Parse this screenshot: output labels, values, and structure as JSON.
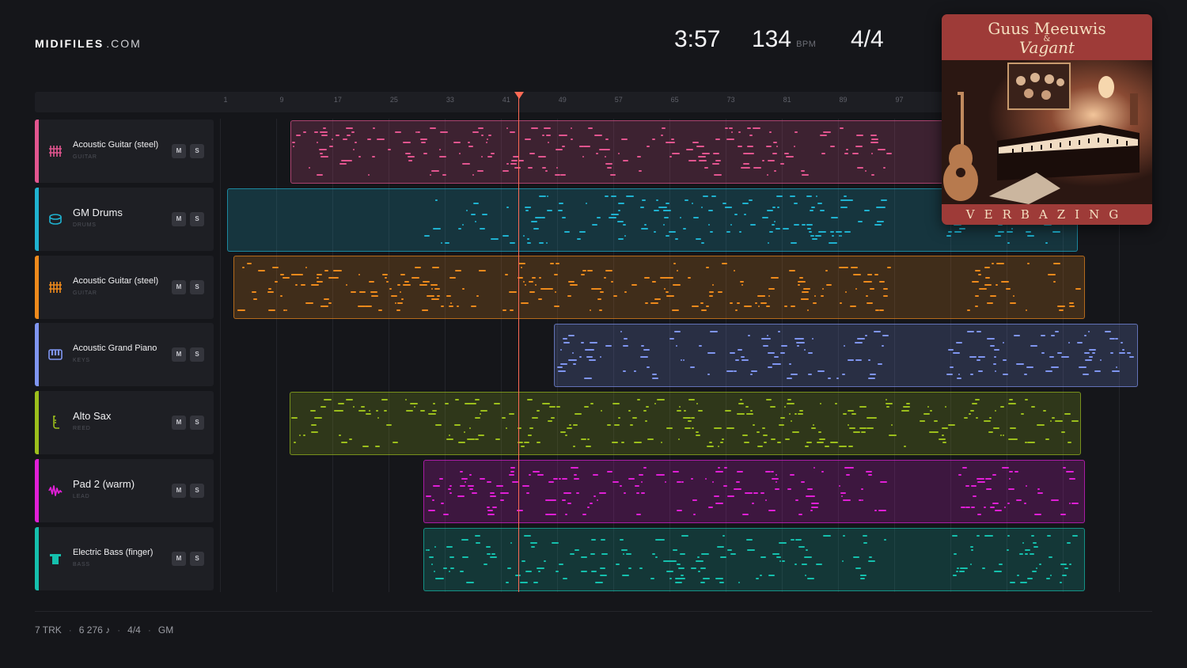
{
  "brand": {
    "name": "MIDIFILES",
    "tld": ".COM"
  },
  "transport": {
    "time": "3:57",
    "bpm": "134",
    "bpm_unit": "BPM",
    "time_signature": "4/4"
  },
  "ruler": {
    "ticks": [
      "1",
      "9",
      "17",
      "25",
      "33",
      "41",
      "49",
      "57",
      "65",
      "73",
      "81",
      "89",
      "97"
    ]
  },
  "tracks": [
    {
      "name": "Acoustic Guitar (steel)",
      "category": "GUITAR",
      "icon": "guitar-icon",
      "color": "#e2558f",
      "mute_label": "M",
      "solo_label": "S"
    },
    {
      "name": "GM Drums",
      "category": "DRUMS",
      "icon": "drum-icon",
      "color": "#1fb2d0",
      "mute_label": "M",
      "solo_label": "S"
    },
    {
      "name": "Acoustic Guitar (steel)",
      "category": "GUITAR",
      "icon": "guitar-icon",
      "color": "#ee8a1c",
      "mute_label": "M",
      "solo_label": "S"
    },
    {
      "name": "Acoustic Grand Piano",
      "category": "KEYS",
      "icon": "piano-icon",
      "color": "#7f95f0",
      "mute_label": "M",
      "solo_label": "S"
    },
    {
      "name": "Alto Sax",
      "category": "REED",
      "icon": "sax-icon",
      "color": "#9cbf1c",
      "mute_label": "M",
      "solo_label": "S"
    },
    {
      "name": "Pad 2 (warm)",
      "category": "LEAD",
      "icon": "wave-icon",
      "color": "#e01fd6",
      "mute_label": "M",
      "solo_label": "S"
    },
    {
      "name": "Electric Bass (finger)",
      "category": "BASS",
      "icon": "bass-icon",
      "color": "#15c0ad",
      "mute_label": "M",
      "solo_label": "S"
    }
  ],
  "album": {
    "artist": "Guus Meeuwis",
    "ampersand": "&",
    "band": "Vagant",
    "title": "VERBAZING"
  },
  "footer": {
    "tracks": "7 TRK",
    "notes": "6 276 ♪",
    "time_signature": "4/4",
    "standard": "GM"
  }
}
